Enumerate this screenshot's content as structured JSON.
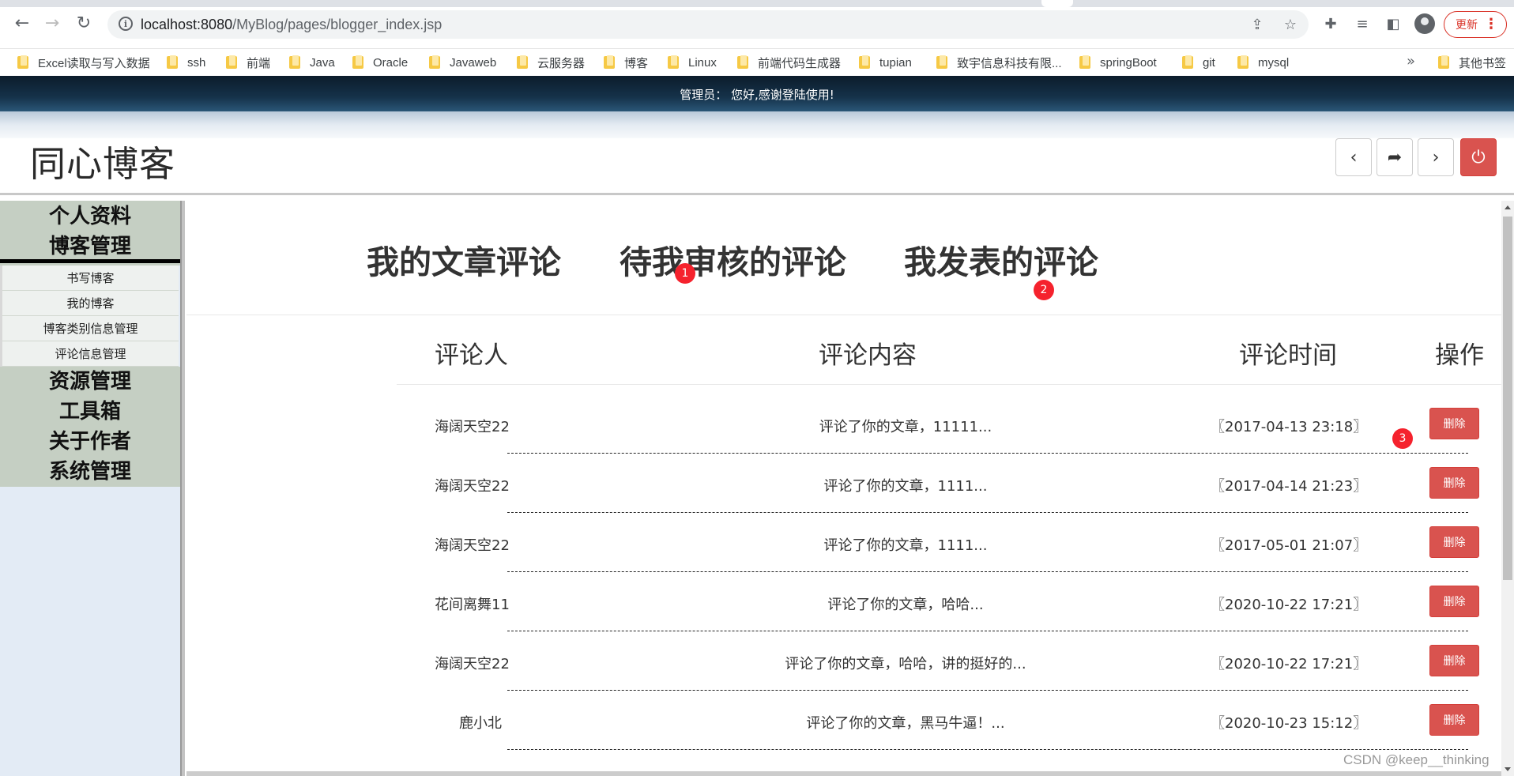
{
  "browser": {
    "url_host": "localhost:8080",
    "url_path": "/MyBlog/pages/blogger_index.jsp",
    "update_label": "更新",
    "bookmarks": [
      "Excel读取与写入数据",
      "ssh",
      "前端",
      "Java",
      "Oracle",
      "Javaweb",
      "云服务器",
      "博客",
      "Linux",
      "前端代码生成器",
      "tupian",
      "致宇信息科技有限...",
      "springBoot",
      "git",
      "mysql"
    ],
    "other_bookmarks": "其他书签"
  },
  "page": {
    "welcome": "管理员：   您好,感谢登陆使用!",
    "site_title": "同心博客"
  },
  "sidebar": {
    "top_items": [
      "个人资料",
      "博客管理"
    ],
    "sub_items": [
      "书写博客",
      "我的博客",
      "博客类别信息管理",
      "评论信息管理"
    ],
    "bottom_items": [
      "资源管理",
      "工具箱",
      "关于作者",
      "系统管理"
    ]
  },
  "tabs": [
    "我的文章评论",
    "待我审核的评论",
    "我发表的评论"
  ],
  "badges": [
    "1",
    "2",
    "3"
  ],
  "table": {
    "headers": [
      "评论人",
      "评论内容",
      "评论时间",
      "操作"
    ],
    "delete_label": "删除",
    "rows": [
      {
        "author": "海阔天空22",
        "content": "评论了你的文章，11111...",
        "time": "〖2017-04-13 23:18〗"
      },
      {
        "author": "海阔天空22",
        "content": "评论了你的文章，1111...",
        "time": "〖2017-04-14 21:23〗"
      },
      {
        "author": "海阔天空22",
        "content": "评论了你的文章，1111...",
        "time": "〖2017-05-01 21:07〗"
      },
      {
        "author": "花间离舞11",
        "content": "评论了你的文章，哈哈...",
        "time": "〖2020-10-22 17:21〗"
      },
      {
        "author": "海阔天空22",
        "content": "评论了你的文章，哈哈，讲的挺好的...",
        "time": "〖2020-10-22 17:21〗"
      },
      {
        "author": "鹿小北",
        "content": "评论了你的文章，黑马牛逼！...",
        "time": "〖2020-10-23 15:12〗"
      }
    ]
  },
  "watermark": "CSDN @keep__thinking",
  "colors": {
    "danger": "#d9534f",
    "badge": "#f5222d",
    "sidebar_menu": "#c5cfc3",
    "topbar": "#15324a"
  }
}
